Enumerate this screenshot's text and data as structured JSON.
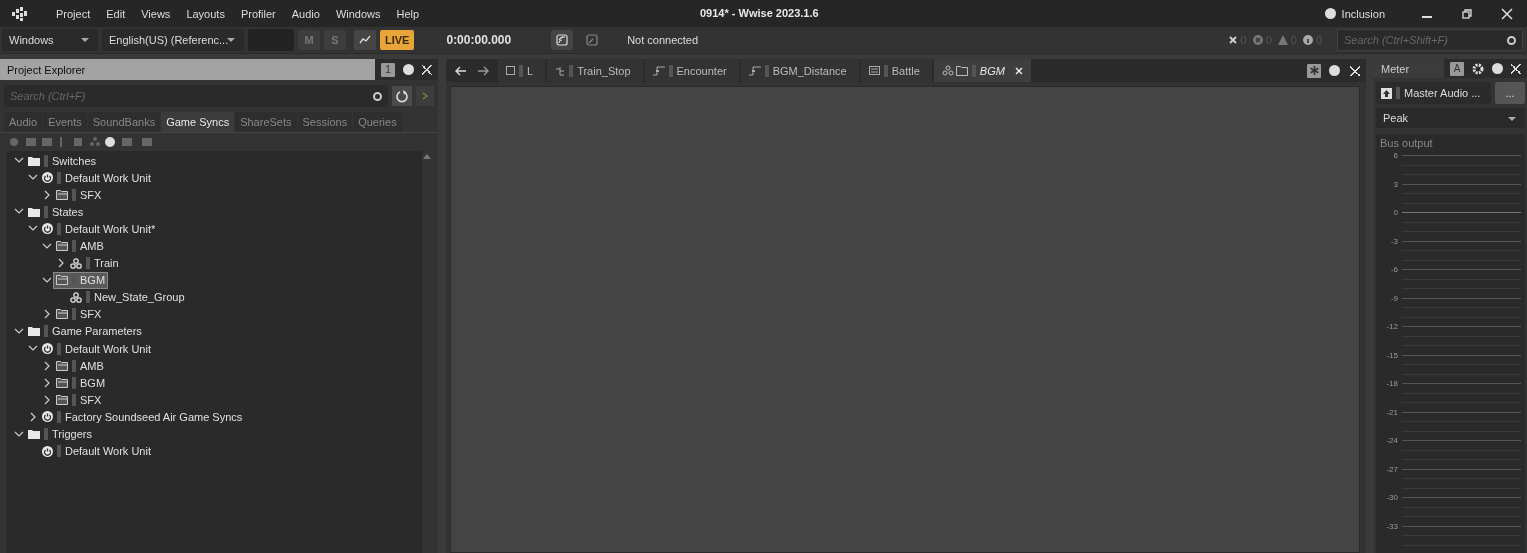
{
  "window": {
    "title": "0914* - Wwise 2023.1.6",
    "layout_label": "Inclusion"
  },
  "menu": [
    "Project",
    "Edit",
    "Views",
    "Layouts",
    "Profiler",
    "Audio",
    "Windows",
    "Help"
  ],
  "toolbar": {
    "platform": "Windows",
    "language": "English(US) (Referenc...",
    "mute": "M",
    "solo": "S",
    "live": "LIVE",
    "time": "0:00:00.000",
    "connection": "Not connected",
    "counts": [
      "0",
      "0",
      "0",
      "0"
    ],
    "search_placeholder": "Search (Ctrl+Shift+F)"
  },
  "project_explorer": {
    "title": "Project Explorer",
    "badge": "1",
    "search_placeholder": "Search (Ctrl+F)",
    "tabs": [
      {
        "label": "Audio",
        "selected": false
      },
      {
        "label": "Events",
        "selected": false
      },
      {
        "label": "SoundBanks",
        "selected": false
      },
      {
        "label": "Game Syncs",
        "selected": true
      },
      {
        "label": "ShareSets",
        "selected": false
      },
      {
        "label": "Sessions",
        "selected": false
      },
      {
        "label": "Queries",
        "selected": false
      }
    ],
    "tree": [
      {
        "label": "Switches",
        "kind": "category",
        "expandable": true,
        "expanded": true,
        "selected": false,
        "children": [
          {
            "label": "Default Work Unit",
            "kind": "work_unit",
            "expandable": true,
            "expanded": true,
            "selected": false,
            "children": [
              {
                "label": "SFX",
                "kind": "folder",
                "expandable": true,
                "expanded": false,
                "selected": false
              }
            ]
          }
        ]
      },
      {
        "label": "States",
        "kind": "category",
        "expandable": true,
        "expanded": true,
        "selected": false,
        "children": [
          {
            "label": "Default Work Unit*",
            "kind": "work_unit",
            "expandable": true,
            "expanded": true,
            "selected": false,
            "children": [
              {
                "label": "AMB",
                "kind": "folder",
                "expandable": true,
                "expanded": true,
                "selected": false,
                "children": [
                  {
                    "label": "Train",
                    "kind": "group",
                    "expandable": true,
                    "expanded": false,
                    "selected": false
                  }
                ]
              },
              {
                "label": "BGM",
                "kind": "folder",
                "expandable": true,
                "expanded": true,
                "selected": true,
                "children": [
                  {
                    "label": "New_State_Group",
                    "kind": "group",
                    "selected": false
                  }
                ]
              },
              {
                "label": "SFX",
                "kind": "folder",
                "expandable": true,
                "expanded": false,
                "selected": false
              }
            ]
          }
        ]
      },
      {
        "label": "Game Parameters",
        "kind": "category",
        "expandable": true,
        "expanded": true,
        "selected": false,
        "children": [
          {
            "label": "Default Work Unit",
            "kind": "work_unit",
            "expandable": true,
            "expanded": true,
            "selected": false,
            "children": [
              {
                "label": "AMB",
                "kind": "folder",
                "expandable": true,
                "expanded": false,
                "selected": false
              },
              {
                "label": "BGM",
                "kind": "folder",
                "expandable": true,
                "expanded": false,
                "selected": false
              },
              {
                "label": "SFX",
                "kind": "folder",
                "expandable": true,
                "expanded": false,
                "selected": false
              }
            ]
          },
          {
            "label": "Factory Soundseed Air Game Syncs",
            "kind": "work_unit",
            "expandable": true,
            "expanded": false,
            "selected": false
          }
        ]
      },
      {
        "label": "Triggers",
        "kind": "category",
        "expandable": true,
        "expanded": true,
        "selected": false,
        "children": [
          {
            "label": "Default Work Unit",
            "kind": "work_unit",
            "selected": false
          }
        ]
      }
    ]
  },
  "editor_tabs": [
    {
      "label": "L",
      "kind": "square",
      "selected": false
    },
    {
      "label": "Train_Stop",
      "kind": "stop",
      "selected": false
    },
    {
      "label": "Encounter",
      "kind": "curve",
      "selected": false
    },
    {
      "label": "BGM_Distance",
      "kind": "curve",
      "selected": false
    },
    {
      "label": "Battle",
      "kind": "list",
      "selected": false
    },
    {
      "label": "BGM",
      "kind": "folder",
      "selected": true
    }
  ],
  "meter": {
    "title": "Meter",
    "badge": "A",
    "bus": "Master Audio ...",
    "more": "...",
    "mode": "Peak",
    "section": "Bus output",
    "scale": [
      "6",
      "3",
      "0",
      "-3",
      "-6",
      "-9",
      "-12",
      "-15",
      "-18",
      "-21",
      "-24",
      "-27",
      "-30",
      "-33"
    ]
  }
}
